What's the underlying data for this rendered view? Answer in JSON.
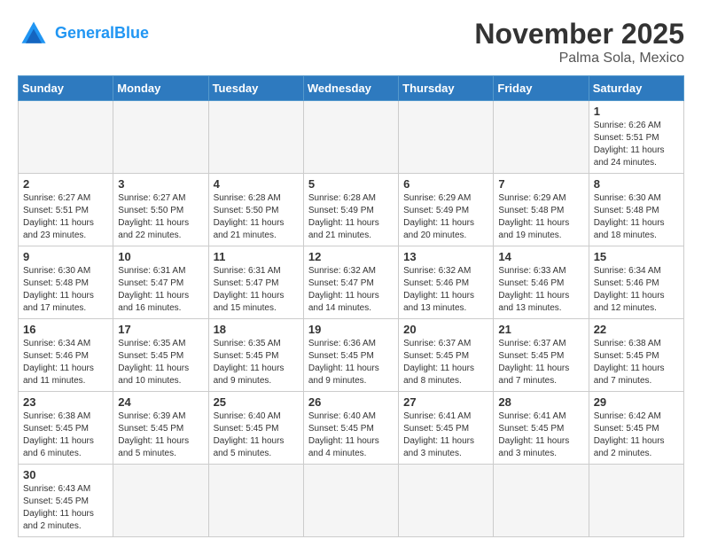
{
  "header": {
    "logo_general": "General",
    "logo_blue": "Blue",
    "month_title": "November 2025",
    "location": "Palma Sola, Mexico"
  },
  "days_of_week": [
    "Sunday",
    "Monday",
    "Tuesday",
    "Wednesday",
    "Thursday",
    "Friday",
    "Saturday"
  ],
  "weeks": [
    [
      {
        "day": "",
        "info": ""
      },
      {
        "day": "",
        "info": ""
      },
      {
        "day": "",
        "info": ""
      },
      {
        "day": "",
        "info": ""
      },
      {
        "day": "",
        "info": ""
      },
      {
        "day": "",
        "info": ""
      },
      {
        "day": "1",
        "info": "Sunrise: 6:26 AM\nSunset: 5:51 PM\nDaylight: 11 hours\nand 24 minutes."
      }
    ],
    [
      {
        "day": "2",
        "info": "Sunrise: 6:27 AM\nSunset: 5:51 PM\nDaylight: 11 hours\nand 23 minutes."
      },
      {
        "day": "3",
        "info": "Sunrise: 6:27 AM\nSunset: 5:50 PM\nDaylight: 11 hours\nand 22 minutes."
      },
      {
        "day": "4",
        "info": "Sunrise: 6:28 AM\nSunset: 5:50 PM\nDaylight: 11 hours\nand 21 minutes."
      },
      {
        "day": "5",
        "info": "Sunrise: 6:28 AM\nSunset: 5:49 PM\nDaylight: 11 hours\nand 21 minutes."
      },
      {
        "day": "6",
        "info": "Sunrise: 6:29 AM\nSunset: 5:49 PM\nDaylight: 11 hours\nand 20 minutes."
      },
      {
        "day": "7",
        "info": "Sunrise: 6:29 AM\nSunset: 5:48 PM\nDaylight: 11 hours\nand 19 minutes."
      },
      {
        "day": "8",
        "info": "Sunrise: 6:30 AM\nSunset: 5:48 PM\nDaylight: 11 hours\nand 18 minutes."
      }
    ],
    [
      {
        "day": "9",
        "info": "Sunrise: 6:30 AM\nSunset: 5:48 PM\nDaylight: 11 hours\nand 17 minutes."
      },
      {
        "day": "10",
        "info": "Sunrise: 6:31 AM\nSunset: 5:47 PM\nDaylight: 11 hours\nand 16 minutes."
      },
      {
        "day": "11",
        "info": "Sunrise: 6:31 AM\nSunset: 5:47 PM\nDaylight: 11 hours\nand 15 minutes."
      },
      {
        "day": "12",
        "info": "Sunrise: 6:32 AM\nSunset: 5:47 PM\nDaylight: 11 hours\nand 14 minutes."
      },
      {
        "day": "13",
        "info": "Sunrise: 6:32 AM\nSunset: 5:46 PM\nDaylight: 11 hours\nand 13 minutes."
      },
      {
        "day": "14",
        "info": "Sunrise: 6:33 AM\nSunset: 5:46 PM\nDaylight: 11 hours\nand 13 minutes."
      },
      {
        "day": "15",
        "info": "Sunrise: 6:34 AM\nSunset: 5:46 PM\nDaylight: 11 hours\nand 12 minutes."
      }
    ],
    [
      {
        "day": "16",
        "info": "Sunrise: 6:34 AM\nSunset: 5:46 PM\nDaylight: 11 hours\nand 11 minutes."
      },
      {
        "day": "17",
        "info": "Sunrise: 6:35 AM\nSunset: 5:45 PM\nDaylight: 11 hours\nand 10 minutes."
      },
      {
        "day": "18",
        "info": "Sunrise: 6:35 AM\nSunset: 5:45 PM\nDaylight: 11 hours\nand 9 minutes."
      },
      {
        "day": "19",
        "info": "Sunrise: 6:36 AM\nSunset: 5:45 PM\nDaylight: 11 hours\nand 9 minutes."
      },
      {
        "day": "20",
        "info": "Sunrise: 6:37 AM\nSunset: 5:45 PM\nDaylight: 11 hours\nand 8 minutes."
      },
      {
        "day": "21",
        "info": "Sunrise: 6:37 AM\nSunset: 5:45 PM\nDaylight: 11 hours\nand 7 minutes."
      },
      {
        "day": "22",
        "info": "Sunrise: 6:38 AM\nSunset: 5:45 PM\nDaylight: 11 hours\nand 7 minutes."
      }
    ],
    [
      {
        "day": "23",
        "info": "Sunrise: 6:38 AM\nSunset: 5:45 PM\nDaylight: 11 hours\nand 6 minutes."
      },
      {
        "day": "24",
        "info": "Sunrise: 6:39 AM\nSunset: 5:45 PM\nDaylight: 11 hours\nand 5 minutes."
      },
      {
        "day": "25",
        "info": "Sunrise: 6:40 AM\nSunset: 5:45 PM\nDaylight: 11 hours\nand 5 minutes."
      },
      {
        "day": "26",
        "info": "Sunrise: 6:40 AM\nSunset: 5:45 PM\nDaylight: 11 hours\nand 4 minutes."
      },
      {
        "day": "27",
        "info": "Sunrise: 6:41 AM\nSunset: 5:45 PM\nDaylight: 11 hours\nand 3 minutes."
      },
      {
        "day": "28",
        "info": "Sunrise: 6:41 AM\nSunset: 5:45 PM\nDaylight: 11 hours\nand 3 minutes."
      },
      {
        "day": "29",
        "info": "Sunrise: 6:42 AM\nSunset: 5:45 PM\nDaylight: 11 hours\nand 2 minutes."
      }
    ],
    [
      {
        "day": "30",
        "info": "Sunrise: 6:43 AM\nSunset: 5:45 PM\nDaylight: 11 hours\nand 2 minutes."
      },
      {
        "day": "",
        "info": ""
      },
      {
        "day": "",
        "info": ""
      },
      {
        "day": "",
        "info": ""
      },
      {
        "day": "",
        "info": ""
      },
      {
        "day": "",
        "info": ""
      },
      {
        "day": "",
        "info": ""
      }
    ]
  ]
}
